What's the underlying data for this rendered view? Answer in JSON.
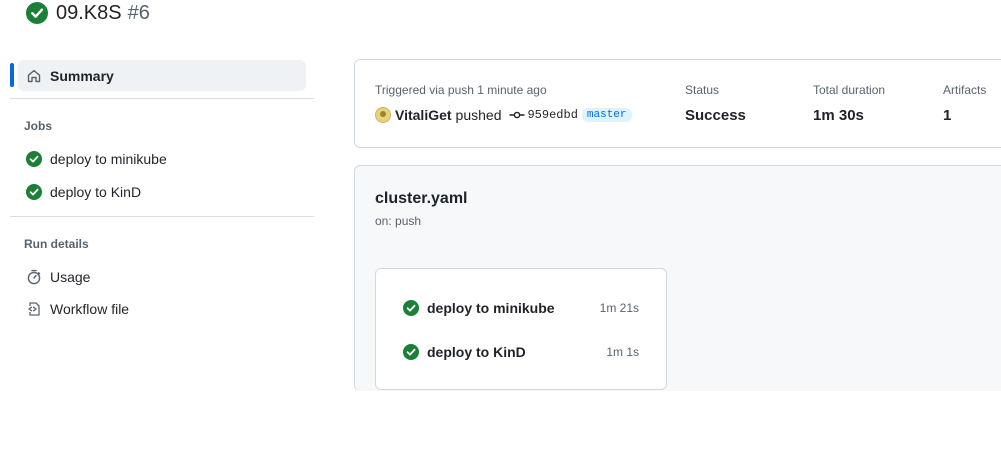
{
  "run": {
    "title": "09.K8S",
    "number": "#6"
  },
  "sidebar": {
    "summary_label": "Summary",
    "jobs_heading": "Jobs",
    "jobs": [
      {
        "label": "deploy to minikube"
      },
      {
        "label": "deploy to KinD"
      }
    ],
    "run_details_heading": "Run details",
    "details": [
      {
        "label": "Usage",
        "icon": "stopwatch-icon"
      },
      {
        "label": "Workflow file",
        "icon": "file-code-icon"
      }
    ]
  },
  "summary": {
    "trigger_label": "Triggered via push 1 minute ago",
    "actor": "VitaliGet",
    "action": "pushed",
    "commit": "959edbd",
    "branch": "master",
    "status_label": "Status",
    "status_value": "Success",
    "duration_label": "Total duration",
    "duration_value": "1m 30s",
    "artifacts_label": "Artifacts",
    "artifacts_value": "1"
  },
  "workflow": {
    "name": "cluster.yaml",
    "trigger": "on: push",
    "jobs": [
      {
        "name": "deploy to minikube",
        "duration": "1m 21s"
      },
      {
        "name": "deploy to KinD",
        "duration": "1m 1s"
      }
    ]
  },
  "colors": {
    "success": "#1a7f37",
    "accent": "#0969da"
  }
}
